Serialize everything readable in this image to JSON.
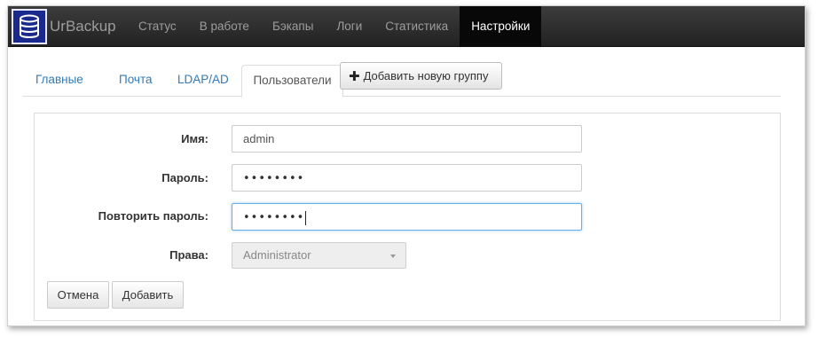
{
  "brand": {
    "name": "UrBackup"
  },
  "nav": {
    "items": [
      {
        "label": "Статус"
      },
      {
        "label": "В работе"
      },
      {
        "label": "Бэкапы"
      },
      {
        "label": "Логи"
      },
      {
        "label": "Статистика"
      },
      {
        "label": "Настройки",
        "active": true
      }
    ]
  },
  "tabs": [
    {
      "label": "Главные"
    },
    {
      "label": "Почта"
    },
    {
      "label": "LDAP/AD"
    },
    {
      "label": "Пользователи",
      "active": true
    }
  ],
  "add_group_button": {
    "label": "Добавить новую группу"
  },
  "form": {
    "name_label": "Имя:",
    "name_value": "admin",
    "password_label": "Пароль:",
    "password_value": "••••••••",
    "repeat_label": "Повторить пароль:",
    "repeat_value": "••••••••",
    "rights_label": "Права:",
    "rights_value": "Administrator"
  },
  "buttons": {
    "cancel": "Отмена",
    "add": "Добавить"
  },
  "colors": {
    "navbar": "#222222",
    "active_nav": "#080808",
    "link": "#337ab7",
    "focus": "#66afe9",
    "logo_bg": "#1a2a8c"
  },
  "icons": {
    "logo": "database-icon",
    "add": "plus-icon",
    "select": "caret-down-icon"
  }
}
